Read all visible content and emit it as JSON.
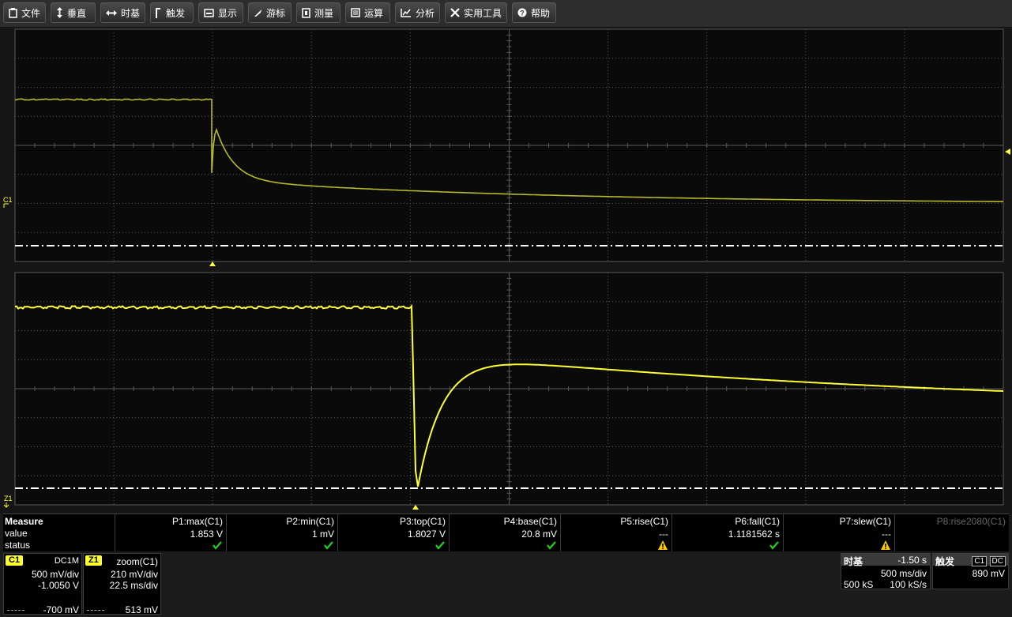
{
  "menu": {
    "file": "文件",
    "vertical": "垂直",
    "timebase": "时基",
    "trigger": "触发",
    "display": "显示",
    "cursors": "游标",
    "measure": "测量",
    "math": "运算",
    "analysis": "分析",
    "utilities": "实用工具",
    "help": "帮助"
  },
  "grid": {
    "c1_label": "C1",
    "z1_label": "Z1"
  },
  "measure": {
    "title": "Measure",
    "value_label": "value",
    "status_label": "status",
    "params": [
      {
        "name": "P1:max(C1)",
        "value": "1.853 V",
        "status": "ok"
      },
      {
        "name": "P2:min(C1)",
        "value": "1 mV",
        "status": "ok"
      },
      {
        "name": "P3:top(C1)",
        "value": "1.8027 V",
        "status": "ok"
      },
      {
        "name": "P4:base(C1)",
        "value": "20.8 mV",
        "status": "ok"
      },
      {
        "name": "P5:rise(C1)",
        "value": "---",
        "status": "warn"
      },
      {
        "name": "P6:fall(C1)",
        "value": "1.1181562 s",
        "status": "ok"
      },
      {
        "name": "P7:slew(C1)",
        "value": "---",
        "status": "warn"
      },
      {
        "name": "P8:rise2080(C1)",
        "value": "",
        "status": "none"
      }
    ]
  },
  "c1": {
    "tag": "C1",
    "coupling": "DC1M",
    "vdiv": "500 mV/div",
    "offset": "-1.0050 V",
    "bottom": "-700 mV"
  },
  "z1": {
    "tag": "Z1",
    "source": "zoom(C1)",
    "vdiv": "210 mV/div",
    "tdiv": "22.5 ms/div",
    "bottom": "513 mV"
  },
  "timebase": {
    "title": "时基",
    "delay": "-1.50 s",
    "tdiv": "500 ms/div",
    "samples": "500 kS",
    "rate": "100 kS/s"
  },
  "trigger": {
    "title": "触发",
    "source": "C1",
    "coupling": "DC",
    "level": "890 mV"
  },
  "colors": {
    "trace_upper": "#b8b82a",
    "trace_lower": "#ffff33",
    "grid": "#5a5a5a",
    "accent": "#ffff2b"
  }
}
